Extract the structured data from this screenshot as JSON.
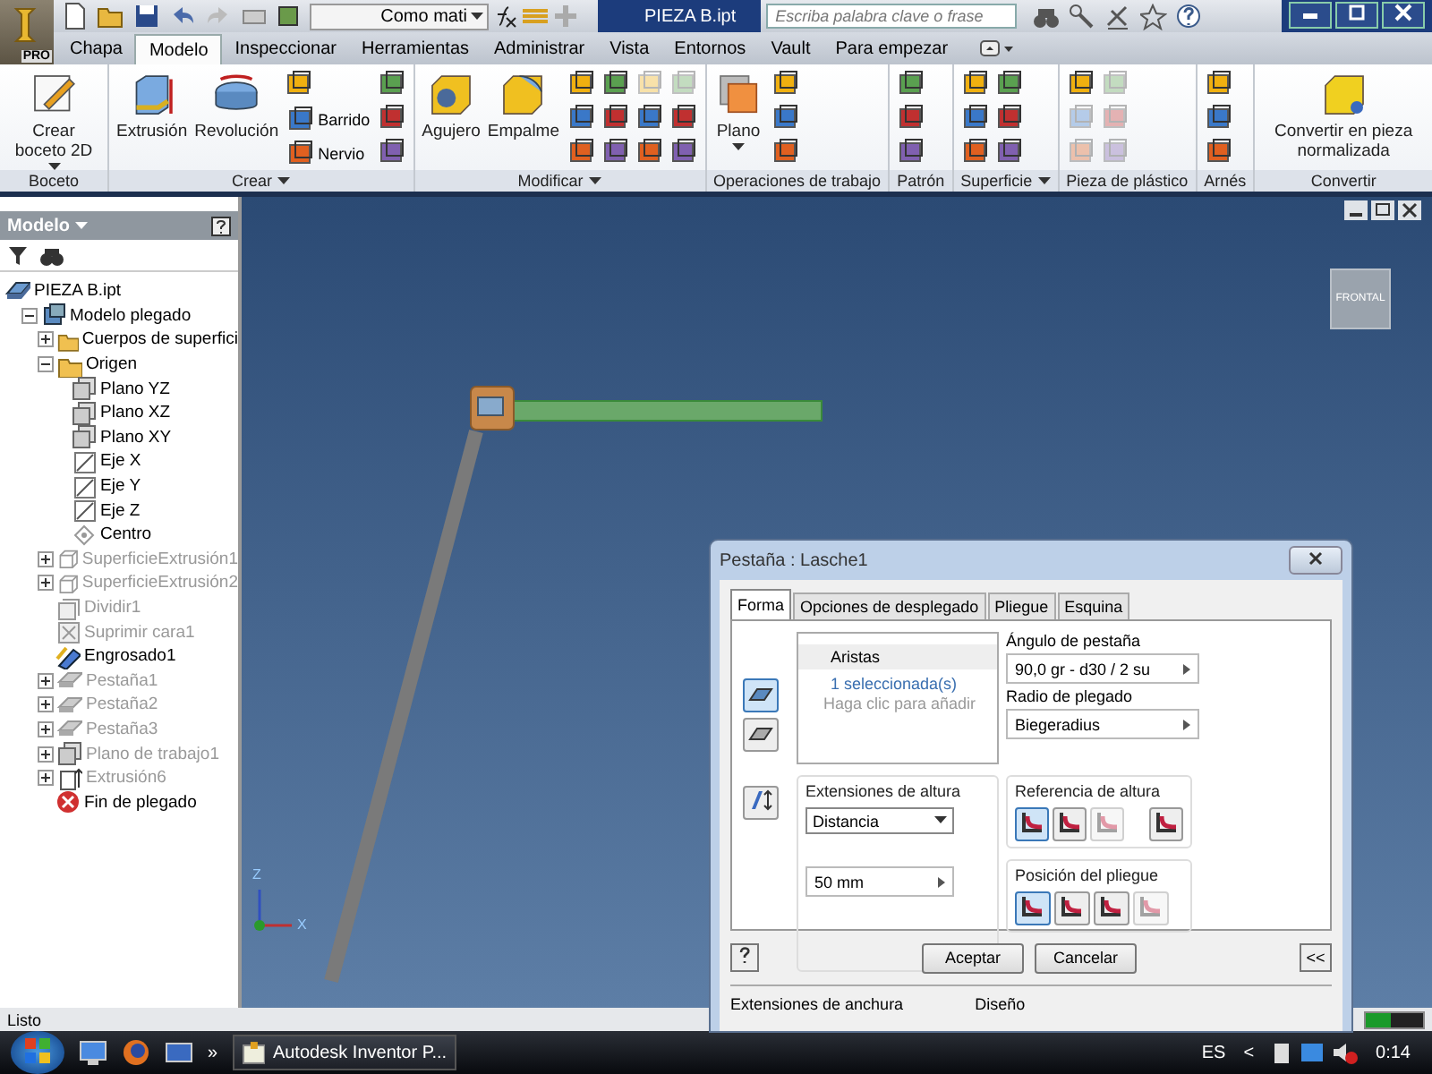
{
  "title_bar": {
    "app_badge": "PRO",
    "style_combo": "Como matі",
    "document_title": "PIEZA B.ipt",
    "search_placeholder": "Escriba palabra clave o frase"
  },
  "tabs": [
    {
      "label": "Chapa",
      "selected": false
    },
    {
      "label": "Modelo",
      "selected": true
    },
    {
      "label": "Inspeccionar",
      "selected": false
    },
    {
      "label": "Herramientas",
      "selected": false
    },
    {
      "label": "Administrar",
      "selected": false
    },
    {
      "label": "Vista",
      "selected": false
    },
    {
      "label": "Entornos",
      "selected": false
    },
    {
      "label": "Vault",
      "selected": false
    },
    {
      "label": "Para empezar",
      "selected": false
    }
  ],
  "ribbon": [
    {
      "title": "Boceto",
      "menu": false,
      "tools": [
        {
          "kind": "large",
          "label": "Crear boceto 2D",
          "dropdown": true
        }
      ]
    },
    {
      "title": "Crear",
      "menu": true,
      "tools": [
        {
          "kind": "large",
          "label": "Extrusión",
          "dropdown": false
        },
        {
          "kind": "large",
          "label": "Revolución",
          "dropdown": false
        },
        {
          "kind": "small",
          "label": "Barrido"
        },
        {
          "kind": "small",
          "label": "Nervio"
        },
        {
          "kind": "column"
        }
      ]
    },
    {
      "title": "Modificar",
      "menu": true,
      "tools": [
        {
          "kind": "large",
          "label": "Agujero",
          "dropdown": false
        },
        {
          "kind": "large",
          "label": "Empalme",
          "dropdown": false
        },
        {
          "kind": "grid",
          "disabled": [
            false,
            false,
            false,
            false,
            false,
            false,
            true,
            false,
            false,
            true,
            false,
            false
          ]
        }
      ]
    },
    {
      "title": "Operaciones de trabajo",
      "menu": false,
      "tools": [
        {
          "kind": "large",
          "label": "Plano",
          "dropdown": true
        },
        {
          "kind": "grid",
          "disabled": [
            false,
            false,
            false
          ]
        }
      ]
    },
    {
      "title": "Patrón",
      "menu": false,
      "tools": [
        {
          "kind": "grid",
          "disabled": [
            false,
            false,
            false
          ]
        }
      ]
    },
    {
      "title": "Superficie",
      "menu": true,
      "tools": [
        {
          "kind": "grid",
          "disabled": [
            false,
            false,
            false,
            false,
            false,
            false
          ]
        }
      ]
    },
    {
      "title": "Pieza de plástico",
      "menu": false,
      "tools": [
        {
          "kind": "grid",
          "disabled": [
            false,
            true,
            true,
            true,
            true,
            true
          ]
        }
      ]
    },
    {
      "title": "Arnés",
      "menu": false,
      "tools": [
        {
          "kind": "grid",
          "disabled": [
            false,
            false,
            false
          ]
        }
      ]
    },
    {
      "title": "Convertir",
      "menu": false,
      "tools": [
        {
          "kind": "large",
          "label": "Convertir en pieza normalizada",
          "dropdown": false
        }
      ]
    }
  ],
  "model_browser": {
    "title": "Modelo",
    "tree": [
      {
        "label": "PIEZA B.ipt",
        "kind": "part",
        "dimmed": false,
        "children": [
          {
            "label": "Modelo plegado",
            "kind": "body",
            "dimmed": false,
            "expanded": true,
            "children": [
              {
                "label": "Cuerpos de superfici",
                "kind": "folder",
                "dimmed": false,
                "expanded": false
              },
              {
                "label": "Origen",
                "kind": "folder",
                "dimmed": false,
                "expanded": true,
                "children": [
                  {
                    "label": "Plano YZ",
                    "kind": "plane",
                    "dimmed": false
                  },
                  {
                    "label": "Plano XZ",
                    "kind": "plane",
                    "dimmed": false
                  },
                  {
                    "label": "Plano XY",
                    "kind": "plane",
                    "dimmed": false
                  },
                  {
                    "label": "Eje X",
                    "kind": "axis",
                    "dimmed": false
                  },
                  {
                    "label": "Eje Y",
                    "kind": "axis",
                    "dimmed": false
                  },
                  {
                    "label": "Eje Z",
                    "kind": "axis",
                    "dimmed": false
                  },
                  {
                    "label": "Centro",
                    "kind": "point",
                    "dimmed": false
                  }
                ]
              },
              {
                "label": "SuperficieExtrusión1",
                "kind": "surface",
                "dimmed": true,
                "expanded": false
              },
              {
                "label": "SuperficieExtrusión2",
                "kind": "surface",
                "dimmed": true,
                "expanded": false
              },
              {
                "label": "Dividir1",
                "kind": "split",
                "dimmed": true
              },
              {
                "label": "Suprimir cara1",
                "kind": "delface",
                "dimmed": true
              },
              {
                "label": "Engrosado1",
                "kind": "thicken",
                "dimmed": false
              },
              {
                "label": "Pestaña1",
                "kind": "flange",
                "dimmed": true,
                "expanded": false
              },
              {
                "label": "Pestaña2",
                "kind": "flange",
                "dimmed": true,
                "expanded": false
              },
              {
                "label": "Pestaña3",
                "kind": "flange",
                "dimmed": true,
                "expanded": false
              },
              {
                "label": "Plano de trabajo1",
                "kind": "plane",
                "dimmed": true,
                "expanded": false
              },
              {
                "label": "Extrusión6",
                "kind": "extrude",
                "dimmed": true,
                "expanded": false
              },
              {
                "label": "Fin de plegado",
                "kind": "end",
                "dimmed": false
              }
            ]
          }
        ]
      }
    ]
  },
  "viewport": {
    "view_cube_label": "FRONTAL",
    "axis_labels": [
      "Z",
      "X"
    ]
  },
  "dialog": {
    "title": "Pestaña : Lasche1",
    "tabs": [
      {
        "label": "Forma",
        "selected": true
      },
      {
        "label": "Opciones de desplegado",
        "selected": false
      },
      {
        "label": "Pliegue",
        "selected": false
      },
      {
        "label": "Esquina",
        "selected": false
      }
    ],
    "mode_buttons": [
      {
        "selected": true
      },
      {
        "selected": false
      }
    ],
    "edges": {
      "header": "Aristas",
      "selected_text": "1 seleccionada(s)",
      "hint": "Haga clic para añadir"
    },
    "angle_label": "Ángulo de pestaña",
    "angle_value": "90,0 gr - d30 / 2 su",
    "radius_label": "Radio de plegado",
    "radius_value": "Biegeradius",
    "height_extents": {
      "title": "Extensiones de altura",
      "option": "Distancia",
      "value": "50 mm"
    },
    "height_reference": {
      "title": "Referencia de altura",
      "buttons": [
        {
          "selected": true,
          "disabled": false
        },
        {
          "selected": false,
          "disabled": false
        },
        {
          "selected": false,
          "disabled": true
        },
        {
          "selected": false,
          "disabled": false
        }
      ]
    },
    "bend_position": {
      "title": "Posición del pliegue",
      "buttons": [
        {
          "selected": true,
          "disabled": false
        },
        {
          "selected": false,
          "disabled": false
        },
        {
          "selected": false,
          "disabled": false
        },
        {
          "selected": false,
          "disabled": true
        }
      ]
    },
    "ok": "Aceptar",
    "cancel": "Cancelar",
    "more": "<<",
    "lower_groups": [
      "Extensiones de anchura",
      "Diseño"
    ]
  },
  "status_bar": {
    "text": "Listo"
  },
  "taskbar": {
    "overflow": "»",
    "task": "Autodesk Inventor P...",
    "language": "ES",
    "tray_toggle": "<",
    "clock": "0:14"
  }
}
